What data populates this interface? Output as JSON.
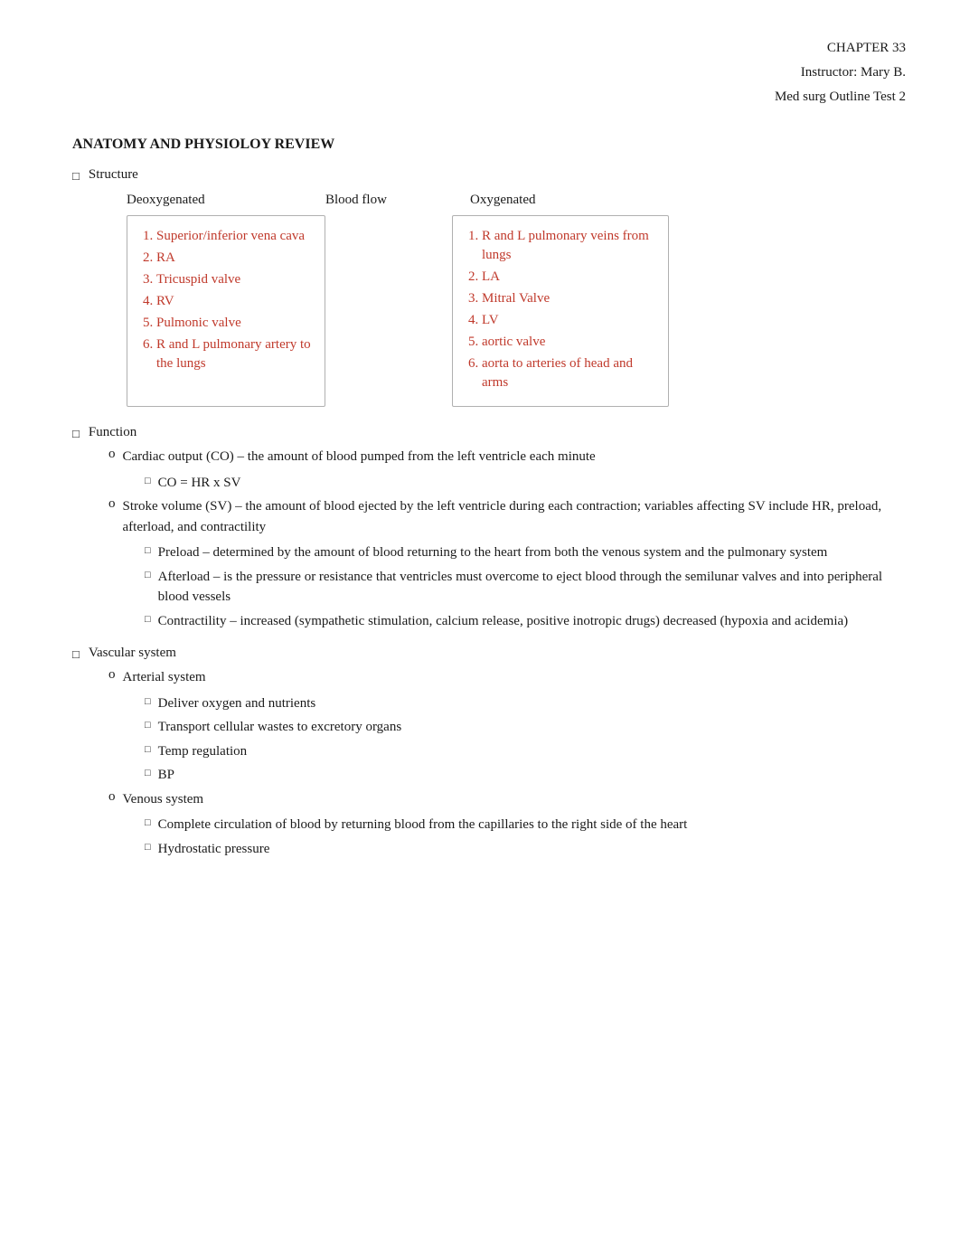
{
  "header": {
    "chapter": "CHAPTER 33",
    "instructor": "Instructor: Mary B.",
    "course": "Med surg Outline Test 2"
  },
  "main_title": "ANATOMY AND PHYSIOLOY REVIEW",
  "sections": [
    {
      "bullet": "□",
      "label": "Structure"
    },
    {
      "bullet": "□",
      "label": "Function"
    },
    {
      "bullet": "□",
      "label": "Vascular system"
    }
  ],
  "flow_table": {
    "col1_header": "Deoxygenated",
    "col2_header": "Blood flow",
    "col3_header": "Oxygenated",
    "deoxygenated_items": [
      "Superior/inferior vena cava",
      "RA",
      "Tricuspid valve",
      "RV",
      "Pulmonic valve",
      "R and L pulmonary artery to the lungs"
    ],
    "oxygenated_items": [
      "R and L pulmonary veins from lungs",
      "LA",
      "Mitral Valve",
      "LV",
      "aortic valve",
      "aorta to arteries of head and arms"
    ]
  },
  "function": {
    "label": "Function",
    "items": [
      {
        "o_label": "o",
        "text": "Cardiac output (CO) – the amount of blood pumped from the left ventricle each minute",
        "sub": [
          {
            "symbol": "□",
            "text": "CO = HR x SV"
          }
        ]
      },
      {
        "o_label": "o",
        "text": "Stroke volume (SV) – the amount of blood ejected by the left ventricle during each contraction; variables affecting SV include HR, preload, afterload, and contractility",
        "sub": [
          {
            "symbol": "□",
            "text": "Preload – determined by the amount of blood returning to the heart from both the venous system and the pulmonary system"
          },
          {
            "symbol": "□",
            "text": "Afterload – is the pressure or resistance that ventricles must overcome to eject blood through the semilunar valves and into peripheral blood vessels"
          },
          {
            "symbol": "□",
            "text": "Contractility – increased (sympathetic stimulation, calcium release, positive inotropic drugs) decreased (hypoxia and acidemia)"
          }
        ]
      }
    ]
  },
  "vascular": {
    "label": "Vascular system",
    "items": [
      {
        "o_label": "o",
        "text": "Arterial system",
        "sub": [
          {
            "symbol": "□",
            "text": "Deliver oxygen and nutrients"
          },
          {
            "symbol": "□",
            "text": "Transport cellular wastes to excretory organs"
          },
          {
            "symbol": "□",
            "text": "Temp regulation"
          },
          {
            "symbol": "□",
            "text": "BP"
          }
        ]
      },
      {
        "o_label": "o",
        "text": "Venous system",
        "sub": [
          {
            "symbol": "□",
            "text": "Complete circulation of blood by returning blood from the capillaries to the right side of the heart"
          },
          {
            "symbol": "□",
            "text": "Hydrostatic pressure"
          }
        ]
      }
    ]
  }
}
